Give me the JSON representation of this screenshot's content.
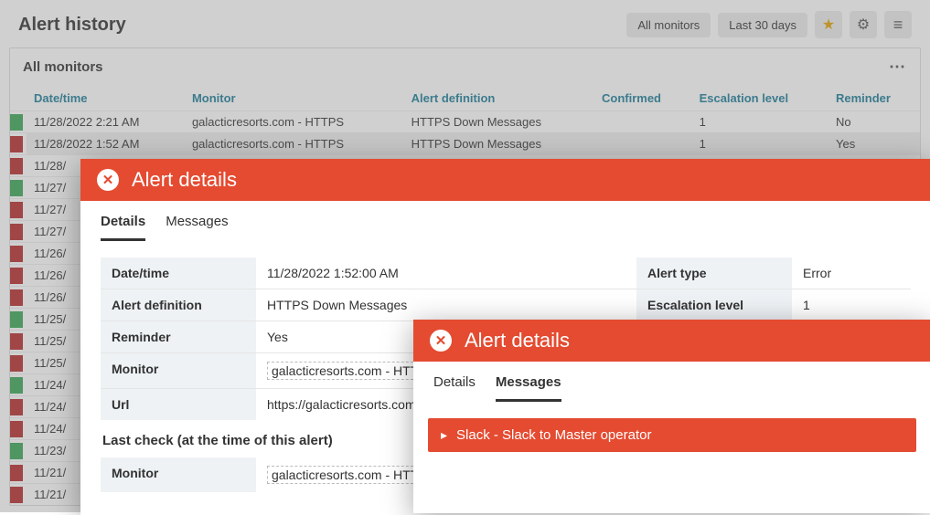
{
  "header": {
    "title": "Alert history",
    "filter_monitors": "All monitors",
    "filter_range": "Last 30 days"
  },
  "panel": {
    "title": "All monitors",
    "columns": {
      "datetime": "Date/time",
      "monitor": "Monitor",
      "alertdef": "Alert definition",
      "confirmed": "Confirmed",
      "escalation": "Escalation level",
      "reminder": "Reminder"
    },
    "rows": [
      {
        "status": "green",
        "dt": "11/28/2022 2:21 AM",
        "mon": "galacticresorts.com - HTTPS",
        "def": "HTTPS Down Messages",
        "conf": "",
        "esc": "1",
        "rem": "No"
      },
      {
        "status": "red",
        "dt": "11/28/2022 1:52 AM",
        "mon": "galacticresorts.com - HTTPS",
        "def": "HTTPS Down Messages",
        "conf": "",
        "esc": "1",
        "rem": "Yes"
      },
      {
        "status": "red",
        "dt": "11/28/"
      },
      {
        "status": "green",
        "dt": "11/27/"
      },
      {
        "status": "red",
        "dt": "11/27/"
      },
      {
        "status": "red",
        "dt": "11/27/"
      },
      {
        "status": "red",
        "dt": "11/26/"
      },
      {
        "status": "red",
        "dt": "11/26/"
      },
      {
        "status": "red",
        "dt": "11/26/"
      },
      {
        "status": "green",
        "dt": "11/25/"
      },
      {
        "status": "red",
        "dt": "11/25/"
      },
      {
        "status": "red",
        "dt": "11/25/"
      },
      {
        "status": "green",
        "dt": "11/24/"
      },
      {
        "status": "red",
        "dt": "11/24/"
      },
      {
        "status": "red",
        "dt": "11/24/"
      },
      {
        "status": "green",
        "dt": "11/23/"
      },
      {
        "status": "red",
        "dt": "11/21/"
      },
      {
        "status": "red",
        "dt": "11/21/"
      }
    ]
  },
  "modal1": {
    "title": "Alert details",
    "tabs": {
      "details": "Details",
      "messages": "Messages"
    },
    "left": [
      {
        "label": "Date/time",
        "value": "11/28/2022 1:52:00 AM",
        "box": false
      },
      {
        "label": "Alert definition",
        "value": "HTTPS Down Messages",
        "box": false
      },
      {
        "label": "Reminder",
        "value": "Yes",
        "box": false
      },
      {
        "label": "Monitor",
        "value": "galacticresorts.com - HTT",
        "box": true
      },
      {
        "label": "Url",
        "value": "https://galacticresorts.com",
        "box": false
      }
    ],
    "right": [
      {
        "label": "Alert type",
        "value": "Error"
      },
      {
        "label": "Escalation level",
        "value": "1"
      }
    ],
    "lastcheck_title": "Last check (at the time of this alert)",
    "lastcheck": [
      {
        "label": "Monitor",
        "value": "galacticresorts.com - HTT",
        "box": true
      }
    ]
  },
  "modal2": {
    "title": "Alert details",
    "tabs": {
      "details": "Details",
      "messages": "Messages"
    },
    "message_row": "Slack - Slack to Master operator"
  }
}
